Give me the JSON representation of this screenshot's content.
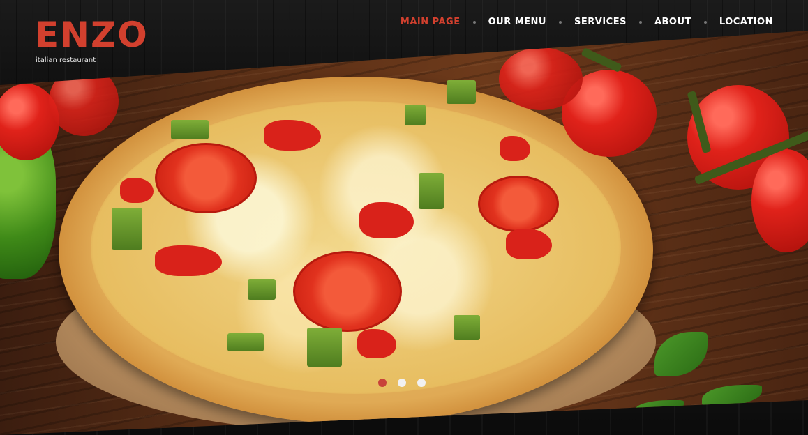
{
  "brand": {
    "name": "ENZO",
    "tagline": "italian restaurant"
  },
  "nav": {
    "items": [
      {
        "label": "MAIN PAGE",
        "active": true
      },
      {
        "label": "OUR MENU",
        "active": false
      },
      {
        "label": "SERVICES",
        "active": false
      },
      {
        "label": "ABOUT",
        "active": false
      },
      {
        "label": "LOCATION",
        "active": false
      }
    ]
  },
  "slider": {
    "image": "pizza-hero-image",
    "dots_total": 3,
    "active_index": 0
  },
  "colors": {
    "accent": "#d2402e",
    "nav_text": "#ffffff",
    "header_bg": "#141414"
  }
}
